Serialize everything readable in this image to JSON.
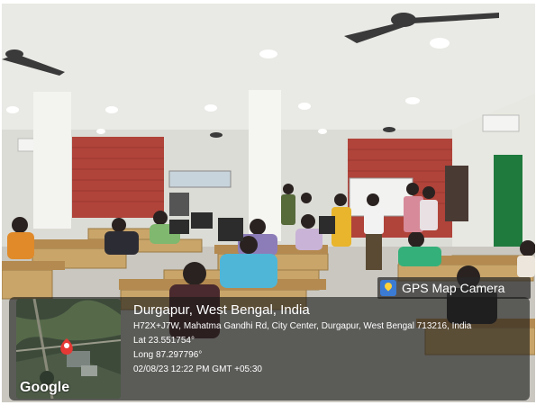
{
  "overlay": {
    "app_label": "GPS Map Camera",
    "app_icon": "gps-map-camera-icon",
    "city": "Durgapur, West Bengal, India",
    "address": "H72X+J7W, Mahatma Gandhi Rd, City Center, Durgapur, West Bengal 713216, India",
    "latitude": "Lat 23.551754°",
    "longitude": "Long 87.297796°",
    "timestamp": "02/08/23 12:22 PM GMT +05:30",
    "map_brand": "Google"
  },
  "colors": {
    "brick": "#b0433a",
    "door_green": "#1f7a3e",
    "map_pin": "#e53935"
  }
}
